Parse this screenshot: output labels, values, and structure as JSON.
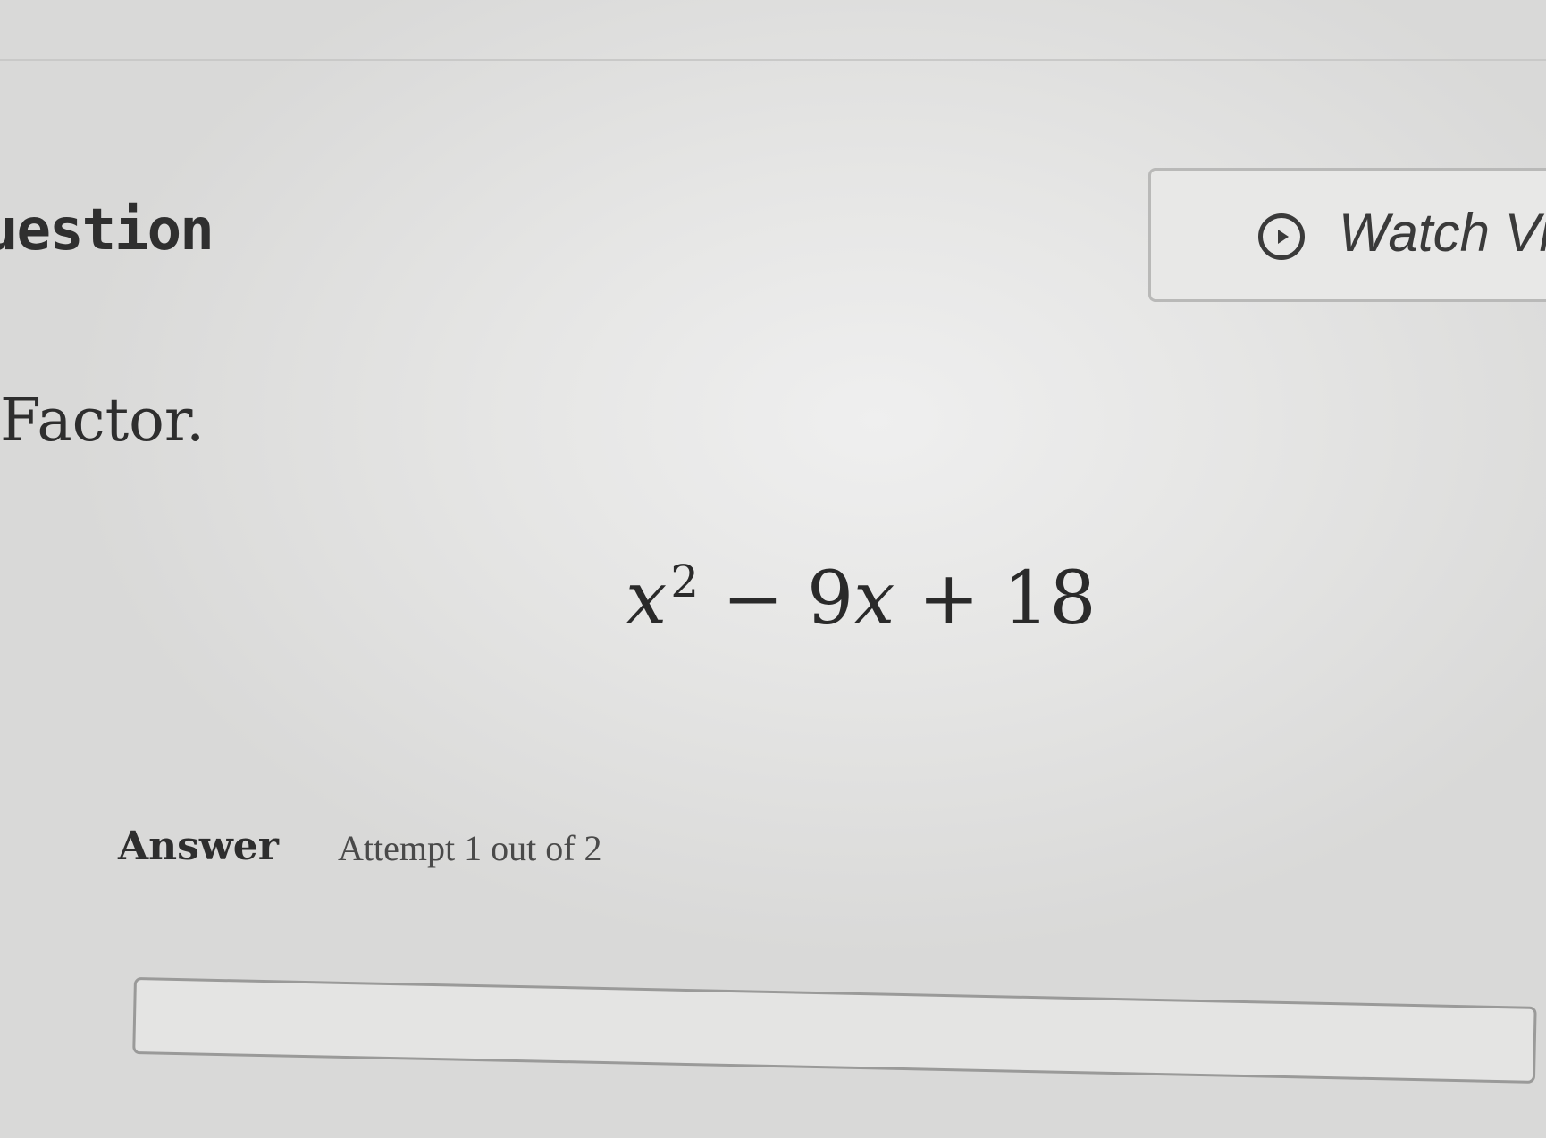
{
  "question": {
    "heading": "uestion",
    "watch_video_label": "Watch Vi",
    "prompt": "Factor."
  },
  "expression": {
    "base_variable": "x",
    "exponent": "2",
    "minus": "−",
    "coefficient": "9",
    "linear_variable": "x",
    "plus": "+",
    "constant": "18"
  },
  "answer": {
    "label": "Answer",
    "attempt_text": "Attempt 1 out of 2",
    "input_value": ""
  },
  "icons": {
    "play": "play-circle-icon"
  }
}
